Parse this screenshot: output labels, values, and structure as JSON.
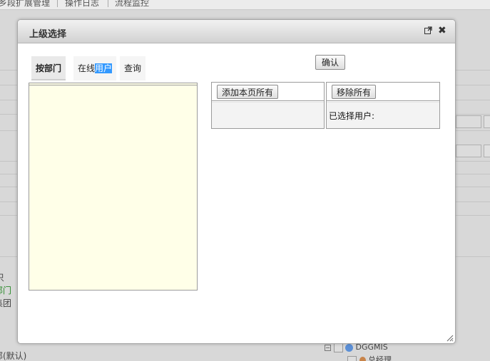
{
  "background": {
    "top_menu": [
      "乡段扩展管理",
      "操作日志",
      "流程监控"
    ],
    "left_texts": [
      "只",
      "部门",
      "集团",
      "部(默认)"
    ],
    "tree_text": "DGGMIS",
    "tree_sub": "总经理"
  },
  "dialog": {
    "title": "上级选择",
    "icons": {
      "popout": "popout-icon",
      "close": "close-icon"
    },
    "tabs": [
      {
        "label": "按部门",
        "active": true
      },
      {
        "label_plain": "在线",
        "label_highlight": "用户",
        "active": false
      },
      {
        "label": "查询",
        "active": false
      }
    ],
    "confirm_label": "确认",
    "add_all_label": "添加本页所有",
    "remove_all_label": "移除所有",
    "selected_users_label": "已选择用户:"
  },
  "colors": {
    "highlight": "#3399ff",
    "tree_panel_bg": "#ffffe8"
  }
}
